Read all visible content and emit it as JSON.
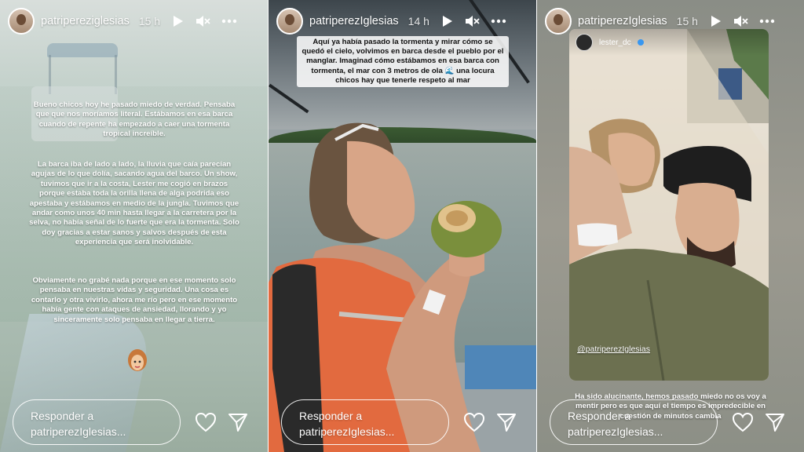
{
  "stories": [
    {
      "username": "patripereziglesias",
      "time": "15 h",
      "reply_line1": "Responder a",
      "reply_line2": "patriperezIglesias...",
      "paragraphs": [
        "Bueno chicos hoy he pasado miedo de verdad. Pensaba que que nos moríamos literal. Estábamos en esa barca cuando de repente ha empezado a caer una tormenta tropical increíble.",
        "La barca iba de lado a lado, la lluvia que caía parecían agujas de lo que dolía, sacando agua del barco. Un show, tuvimos que ir a la costa, Lester me cogió en brazos porque estaba toda la orilla llena de alga podrida eso apestaba y estábamos en medio de la jungla.  Tuvimos que andar como unos 40 min hasta llegar a la carretera por la selva, no había señal de lo fuerte que era la tormenta.  Solo doy gracias a estar sanos y salvos después de esta experiencia que será inolvidable.",
        "Obviamente no grabé nada porque en ese momento solo pensaba en nuestras vidas y seguridad. Una cosa es contarlo y otra vivirlo, ahora me río pero en ese momento había gente con ataques de ansiedad, llorando y yo sinceramente solo pensaba en llegar a tierra."
      ]
    },
    {
      "username": "patriperezIglesias",
      "time": "14 h",
      "reply_line1": "Responder a",
      "reply_line2": "patriperezIglesias...",
      "caption": "Aquí ya había pasado la tormenta y mirar cómo se quedó el cielo, volvimos en barca desde el pueblo por el manglar. Imaginad cómo estábamos en esa barca con tormenta, el mar con 3 metros de ola 🌊 una locura chicos hay que tenerle respeto al mar"
    },
    {
      "username": "patriperezIglesias",
      "time": "15 h",
      "reply_line1": "Responder a",
      "reply_line2": "patriperezIglesias...",
      "inner_username": "lester_dc",
      "mention": "@patriperezIglesias",
      "caption": "Ha sido alucinante, hemos pasado miedo no os voy a mentir pero es que aquí el tiempo es impredecible en cuestión de minutos cambia"
    }
  ],
  "colors": {
    "text": "#ffffff",
    "accent_blue": "#3897f0"
  }
}
